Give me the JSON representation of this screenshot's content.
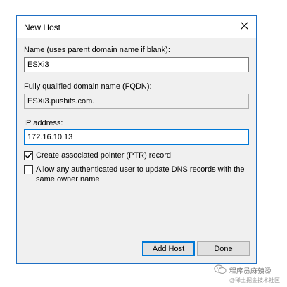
{
  "dialog": {
    "title": "New Host",
    "close_icon": "close-icon"
  },
  "form": {
    "name_label": "Name (uses parent domain name if blank):",
    "name_value": "ESXi3",
    "fqdn_label": "Fully qualified domain name (FQDN):",
    "fqdn_value": "ESXi3.pushits.com.",
    "ip_label": "IP address:",
    "ip_value": "172.16.10.13",
    "ptr_checkbox": {
      "label": "Create associated pointer (PTR) record",
      "checked": true
    },
    "auth_checkbox": {
      "label": "Allow any authenticated user to update DNS records with the same owner name",
      "checked": false
    }
  },
  "buttons": {
    "add_host_label": "Add Host",
    "done_label": "Done"
  },
  "watermark": {
    "line1": "程序员麻辣烫",
    "line2": "@稀土掘金技术社区",
    "icon": "wechat-icon"
  },
  "colors": {
    "accent": "#0078d7",
    "dialog_border": "#1f6fc4",
    "client_bg": "#f0f0f0"
  }
}
